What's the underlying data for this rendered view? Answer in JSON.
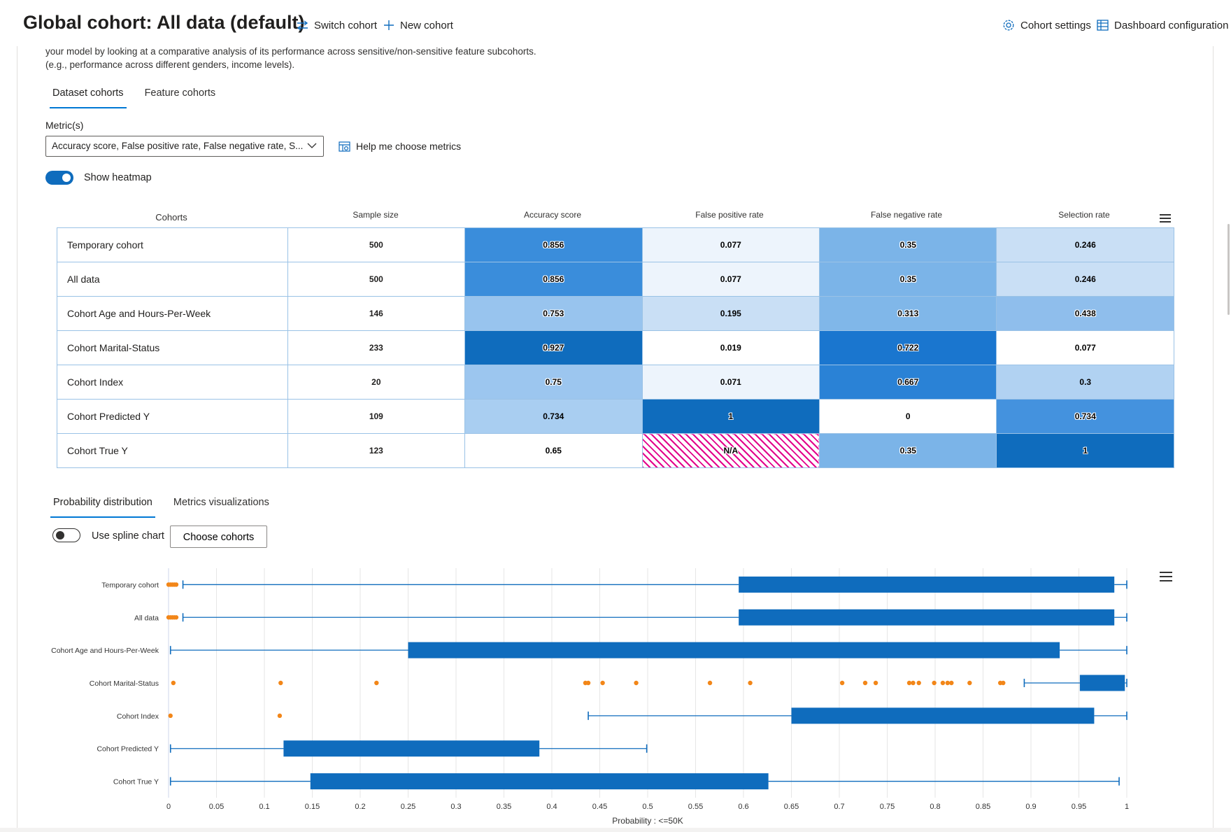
{
  "header": {
    "title": "Global cohort: All data (default)",
    "switch_cohort": "Switch cohort",
    "new_cohort": "New cohort",
    "cohort_settings": "Cohort settings",
    "dashboard_configuration": "Dashboard configuration"
  },
  "description": {
    "line1": "your model by looking at a comparative analysis of its performance across sensitive/non-sensitive feature subcohorts.",
    "line2": "(e.g., performance across different genders, income levels)."
  },
  "cohort_tabs": {
    "dataset": "Dataset cohorts",
    "feature": "Feature cohorts"
  },
  "metrics": {
    "label": "Metric(s)",
    "selected": "Accuracy score, False positive rate, False negative rate, S...",
    "help": "Help me choose metrics"
  },
  "heatmap_toggle": {
    "label": "Show heatmap",
    "on": true
  },
  "heatmap": {
    "columns": [
      "Cohorts",
      "Sample size",
      "Accuracy score",
      "False positive rate",
      "False negative rate",
      "Selection rate"
    ],
    "rows": [
      {
        "name": "Temporary cohort",
        "size": "500",
        "values": [
          "0.856",
          "0.077",
          "0.35",
          "0.246"
        ],
        "shade": [
          3,
          0,
          2,
          1
        ]
      },
      {
        "name": "All data",
        "size": "500",
        "values": [
          "0.856",
          "0.077",
          "0.35",
          "0.246"
        ],
        "shade": [
          3,
          0,
          2,
          1
        ]
      },
      {
        "name": "Cohort Age and Hours-Per-Week",
        "size": "146",
        "values": [
          "0.753",
          "0.195",
          "0.313",
          "0.438"
        ],
        "shade": [
          2,
          1,
          2,
          2
        ]
      },
      {
        "name": "Cohort Marital-Status",
        "size": "233",
        "values": [
          "0.927",
          "0.019",
          "0.722",
          "0.077"
        ],
        "shade": [
          4,
          0,
          4,
          0
        ]
      },
      {
        "name": "Cohort Index",
        "size": "20",
        "values": [
          "0.75",
          "0.071",
          "0.667",
          "0.3"
        ],
        "shade": [
          2,
          0,
          4,
          1
        ]
      },
      {
        "name": "Cohort Predicted Y",
        "size": "109",
        "values": [
          "0.734",
          "1",
          "0",
          "0.734"
        ],
        "shade": [
          1,
          5,
          0,
          3
        ]
      },
      {
        "name": "Cohort True Y",
        "size": "123",
        "values": [
          "0.65",
          "N/A",
          "0.35",
          "1"
        ],
        "shade": [
          0,
          -1,
          2,
          5
        ]
      }
    ],
    "colors": {
      "accent": "#0f6cbd",
      "na_hatch": "#e3008c"
    }
  },
  "chart_tabs": {
    "probability": "Probability distribution",
    "metrics": "Metrics visualizations"
  },
  "spline_toggle": {
    "label": "Use spline chart",
    "on": false
  },
  "choose_cohorts": "Choose cohorts",
  "chart_data": {
    "type": "boxplot",
    "orientation": "horizontal",
    "xlabel": "Probability : <=50K",
    "xlim": [
      0,
      1
    ],
    "xticks": [
      "0",
      "0.05",
      "0.1",
      "0.15",
      "0.2",
      "0.25",
      "0.3",
      "0.35",
      "0.4",
      "0.45",
      "0.5",
      "0.55",
      "0.6",
      "0.65",
      "0.7",
      "0.75",
      "0.8",
      "0.85",
      "0.9",
      "0.95",
      "1"
    ],
    "box_color": "#0f6cbd",
    "outlier_color": "#f28618",
    "categories": [
      "Temporary cohort",
      "All data",
      "Cohort Age and Hours-Per-Week",
      "Cohort Marital-Status",
      "Cohort Index",
      "Cohort Predicted Y",
      "Cohort True Y"
    ],
    "series": [
      {
        "low": 0.015,
        "q1": 0.595,
        "q3": 0.987,
        "high": 1.0,
        "outliers": [
          0.0,
          0.002,
          0.004,
          0.006,
          0.008
        ]
      },
      {
        "low": 0.015,
        "q1": 0.595,
        "q3": 0.987,
        "high": 1.0,
        "outliers": [
          0.0,
          0.002,
          0.004,
          0.006,
          0.008
        ]
      },
      {
        "low": 0.002,
        "q1": 0.25,
        "q3": 0.93,
        "high": 1.0,
        "outliers": []
      },
      {
        "low": 0.893,
        "q1": 0.951,
        "q3": 0.998,
        "high": 1.0,
        "outliers": [
          0.005,
          0.117,
          0.217,
          0.435,
          0.438,
          0.453,
          0.488,
          0.565,
          0.607,
          0.703,
          0.727,
          0.738,
          0.773,
          0.777,
          0.783,
          0.799,
          0.808,
          0.813,
          0.817,
          0.836,
          0.868,
          0.871
        ]
      },
      {
        "low": 0.438,
        "q1": 0.65,
        "q3": 0.966,
        "high": 1.0,
        "outliers": [
          0.002,
          0.116
        ]
      },
      {
        "low": 0.002,
        "q1": 0.12,
        "q3": 0.387,
        "high": 0.499,
        "outliers": []
      },
      {
        "low": 0.002,
        "q1": 0.148,
        "q3": 0.626,
        "high": 0.992,
        "outliers": []
      }
    ]
  }
}
